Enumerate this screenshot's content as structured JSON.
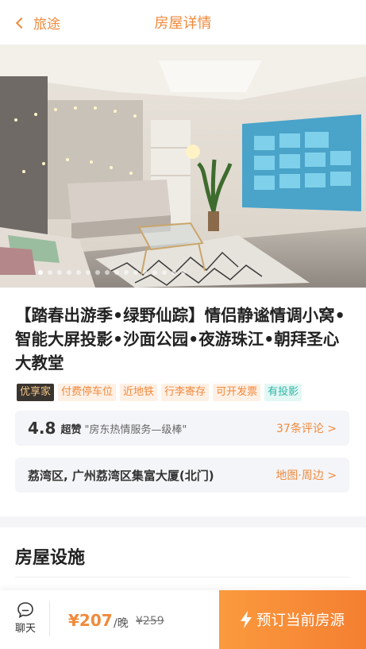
{
  "header": {
    "back_label": "旅途",
    "title": "房屋详情"
  },
  "listing": {
    "title": "【踏春出游季•绿野仙踪】情侣静谧情调小窝•智能大屏投影•沙面公园•夜游珠江•朝拜圣心大教堂",
    "tags": [
      {
        "label": "优享家",
        "style": "dark"
      },
      {
        "label": "付费停车位",
        "style": "orange"
      },
      {
        "label": "近地铁",
        "style": "orange"
      },
      {
        "label": "行李寄存",
        "style": "orange"
      },
      {
        "label": "可开发票",
        "style": "orange"
      },
      {
        "label": "有投影",
        "style": "green"
      }
    ],
    "rating": {
      "score": "4.8",
      "word": "超赞",
      "quote": "\"房东热情服务—级棒\"",
      "reviews_label": "37条评论 >"
    },
    "address": {
      "text": "荔湾区, 广州荔湾区集富大厦(北门)",
      "link_label": "地图·周边 >"
    }
  },
  "gallery": {
    "slide_count": 16,
    "active_index": 0
  },
  "facilities": {
    "title": "房屋设施"
  },
  "bottom_bar": {
    "chat_label": "聊天",
    "price": "¥207",
    "per_night": "/晚",
    "original_price": "¥259",
    "book_label": "预订当前房源"
  },
  "colors": {
    "accent": "#f08a3c",
    "button_gradient": [
      "#fb9a3e",
      "#f47f31"
    ],
    "green_tag": "#2fb7a6"
  },
  "icons": [
    "chevron-left-icon",
    "chat-icon",
    "lightning-icon"
  ]
}
